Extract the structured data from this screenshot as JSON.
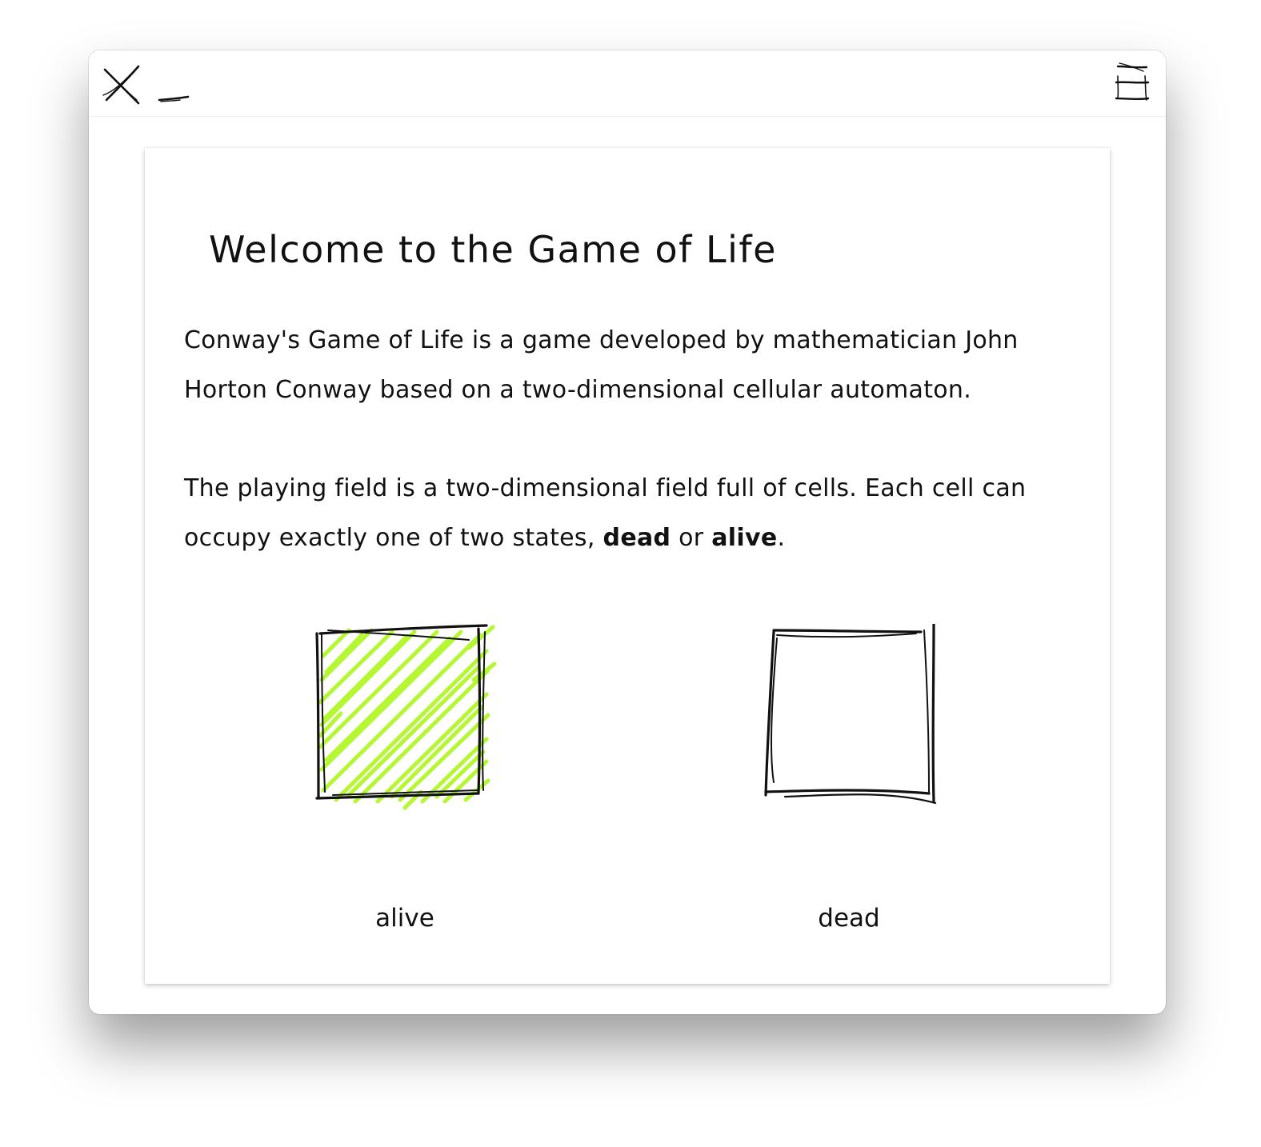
{
  "window": {
    "close_icon": "close-icon",
    "minimize_icon": "minimize-icon",
    "menu_icon": "menu-icon"
  },
  "card": {
    "title": "Welcome to the Game of Life",
    "paragraph1": "Conway's Game of Life is a game developed by mathematician John Horton Conway based on a two-dimensional cellular automaton.",
    "paragraph2": {
      "text_before": "The playing field is a two-dimensional field full of cells. Each cell can occupy exactly one of two states, ",
      "dead_word": "dead",
      "connector": " or ",
      "alive_word": "alive",
      "end": "."
    },
    "cells": {
      "alive": {
        "label": "alive",
        "fill_color": "#b5f733"
      },
      "dead": {
        "label": "dead",
        "fill_color": "#ffffff"
      }
    }
  }
}
